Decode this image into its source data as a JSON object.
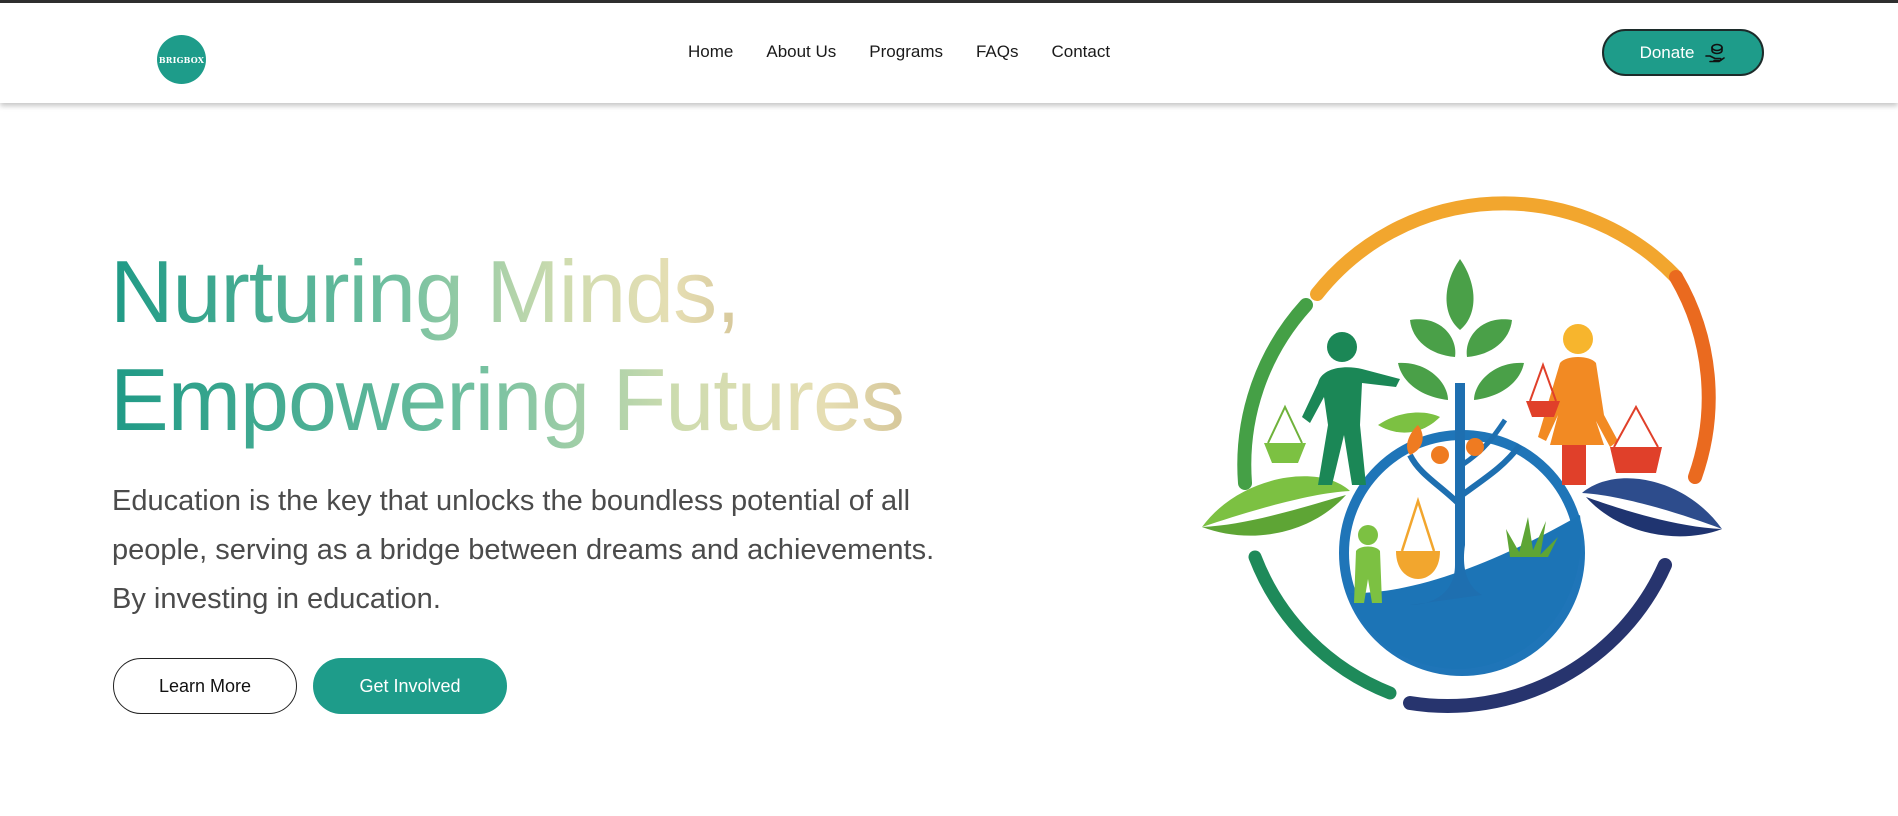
{
  "brand": {
    "logo_text": "BRIGBOX",
    "accent_color": "#1e9c8a"
  },
  "nav": {
    "items": [
      {
        "label": "Home"
      },
      {
        "label": "About Us"
      },
      {
        "label": "Programs"
      },
      {
        "label": "FAQs"
      },
      {
        "label": "Contact"
      }
    ],
    "donate": {
      "label": "Donate",
      "icon": "hand-coin-icon"
    }
  },
  "hero": {
    "title_line1": "Nurturing Minds,",
    "title_line2": "Empowering Futures",
    "description": "Education is the key that unlocks the boundless potential of all people, serving as a bridge between dreams and achievements. By investing in education.",
    "primary_button": "Learn More",
    "secondary_button": "Get Involved",
    "title_gradient": [
      "#1f9a86",
      "#6fbf9f",
      "#cfdcaf",
      "#e6deb3",
      "#d6c79a"
    ],
    "illustration": "education-community-emblem"
  }
}
